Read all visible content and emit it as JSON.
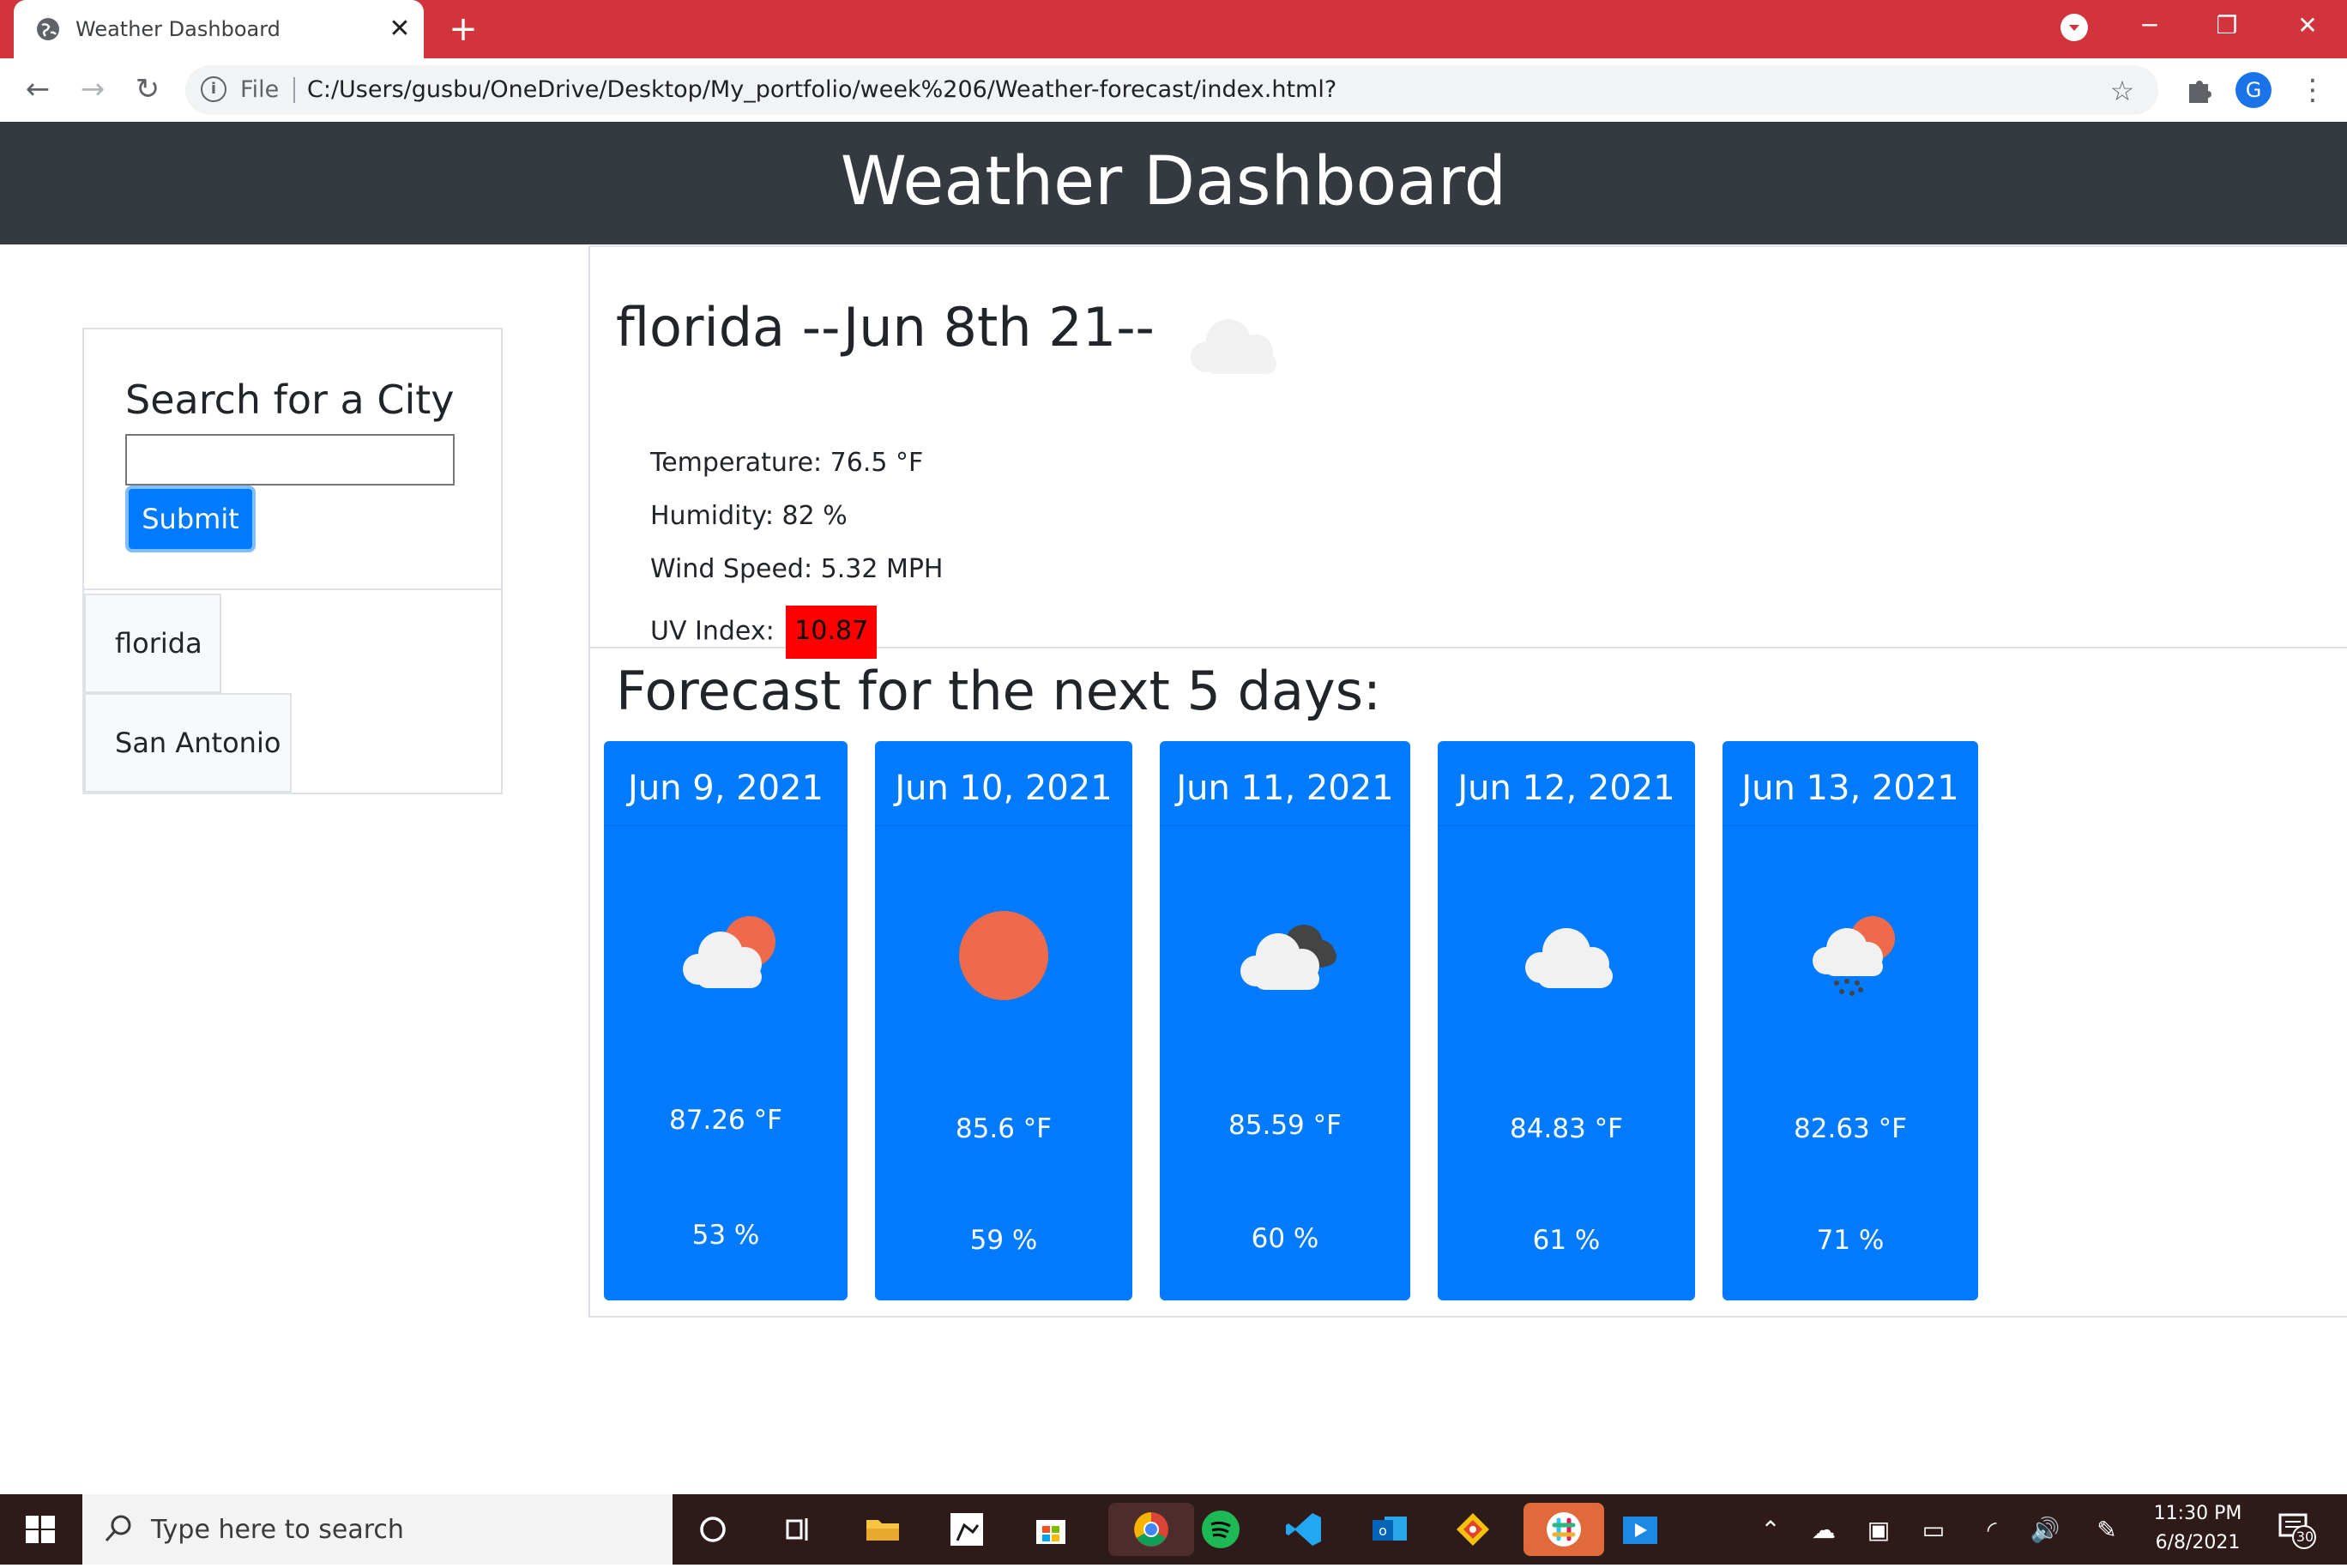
{
  "browser": {
    "tab_title": "Weather Dashboard",
    "url_scheme": "File",
    "url": "C:/Users/gusbu/OneDrive/Desktop/My_portfolio/week%206/Weather-forecast/index.html?",
    "avatar_letter": "G"
  },
  "header": {
    "title": "Weather Dashboard"
  },
  "sidebar": {
    "heading": "Search for a City",
    "search_value": "",
    "submit_label": "Submit",
    "history": [
      "florida",
      "San Antonio"
    ]
  },
  "current": {
    "title": "florida --Jun 8th 21--",
    "icon": "cloud-icon",
    "temperature": "Temperature: 76.5 °F",
    "humidity": "Humidity: 82 %",
    "wind": "Wind Speed: 5.32 MPH",
    "uv_label": "UV Index:",
    "uv_value": "10.87",
    "uv_color": "#ff0000"
  },
  "forecast": {
    "heading": "Forecast for the next 5 days:",
    "days": [
      {
        "date": "Jun 9, 2021",
        "icon": "partly-cloudy-icon",
        "temp": "87.26 °F",
        "humidity": "53 %"
      },
      {
        "date": "Jun 10, 2021",
        "icon": "sun-icon",
        "temp": "85.6 °F",
        "humidity": "59 %"
      },
      {
        "date": "Jun 11, 2021",
        "icon": "broken-clouds-icon",
        "temp": "85.59 °F",
        "humidity": "60 %"
      },
      {
        "date": "Jun 12, 2021",
        "icon": "cloud-icon",
        "temp": "84.83 °F",
        "humidity": "61 %"
      },
      {
        "date": "Jun 13, 2021",
        "icon": "rain-sun-icon",
        "temp": "82.63 °F",
        "humidity": "71 %"
      }
    ]
  },
  "taskbar": {
    "search_placeholder": "Type here to search",
    "time": "11:30 PM",
    "date": "6/8/2021",
    "notification_count": "30"
  },
  "colors": {
    "accent": "#007bff",
    "header_bg": "#343a40",
    "tab_strip": "#d2343b"
  }
}
